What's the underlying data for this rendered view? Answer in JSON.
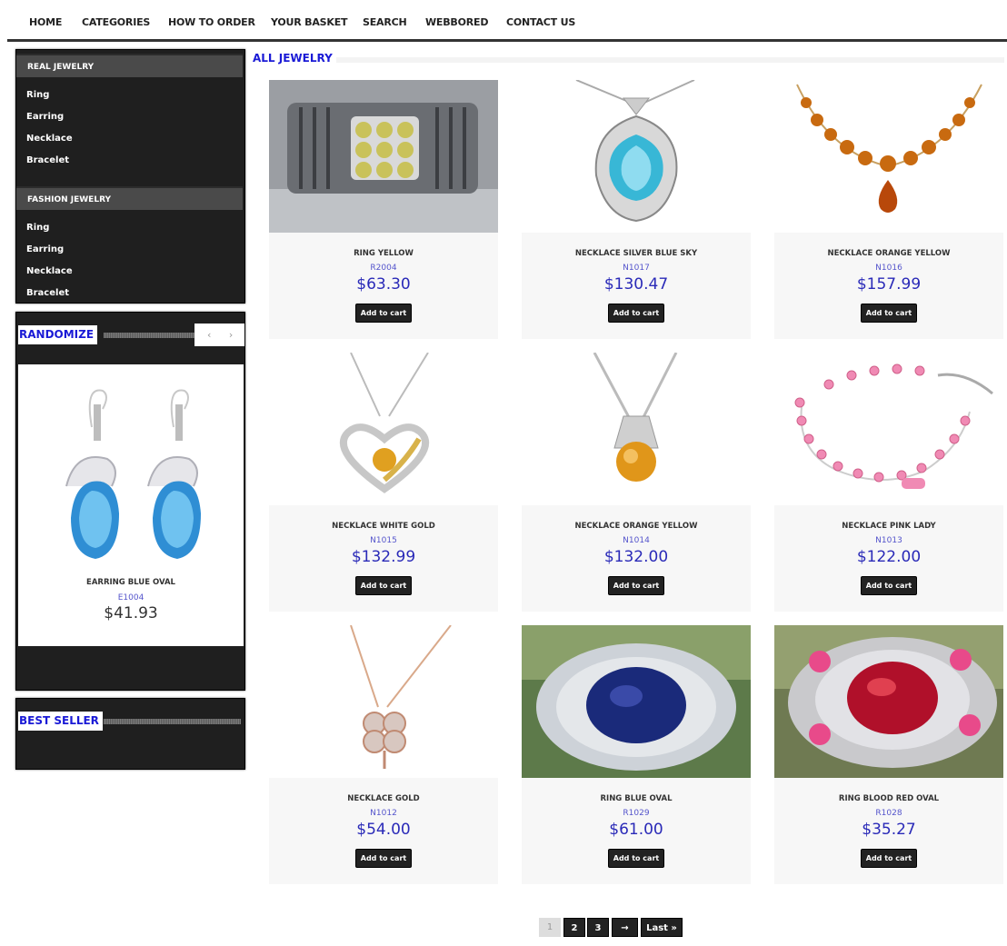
{
  "nav": {
    "items": [
      "HOME",
      "CATEGORIES",
      "HOW TO ORDER",
      "YOUR BASKET",
      "SEARCH",
      "WEBBORED",
      "CONTACT US"
    ]
  },
  "sidebar": {
    "real_heading": "REAL JEWELRY",
    "real_items": [
      "Ring",
      "Earring",
      "Necklace",
      "Bracelet"
    ],
    "fashion_heading": "FASHION JEWELRY",
    "fashion_items": [
      "Ring",
      "Earring",
      "Necklace",
      "Bracelet"
    ],
    "randomize_title": "RANDOMIZE",
    "arrows": "‹ ›",
    "random_product": {
      "name": "EARRING BLUE OVAL",
      "code": "E1004",
      "price": "$41.93"
    },
    "best_seller_title": "BEST SELLER"
  },
  "main": {
    "title": "ALL JEWELRY",
    "add_label": "Add to cart",
    "products": [
      {
        "name": "RING YELLOW",
        "code": "R2004",
        "price": "$63.30"
      },
      {
        "name": "NECKLACE SILVER BLUE SKY",
        "code": "N1017",
        "price": "$130.47"
      },
      {
        "name": "NECKLACE ORANGE YELLOW",
        "code": "N1016",
        "price": "$157.99"
      },
      {
        "name": "NECKLACE WHITE GOLD",
        "code": "N1015",
        "price": "$132.99"
      },
      {
        "name": "NECKLACE ORANGE YELLOW",
        "code": "N1014",
        "price": "$132.00"
      },
      {
        "name": "NECKLACE PINK LADY",
        "code": "N1013",
        "price": "$122.00"
      },
      {
        "name": "NECKLACE GOLD",
        "code": "N1012",
        "price": "$54.00"
      },
      {
        "name": "RING BLUE OVAL",
        "code": "R1029",
        "price": "$61.00"
      },
      {
        "name": "RING BLOOD RED OVAL",
        "code": "R1028",
        "price": "$35.27"
      }
    ]
  },
  "pagination": {
    "current": "1",
    "pages": [
      "2",
      "3"
    ],
    "next": "→",
    "last": "Last »"
  }
}
